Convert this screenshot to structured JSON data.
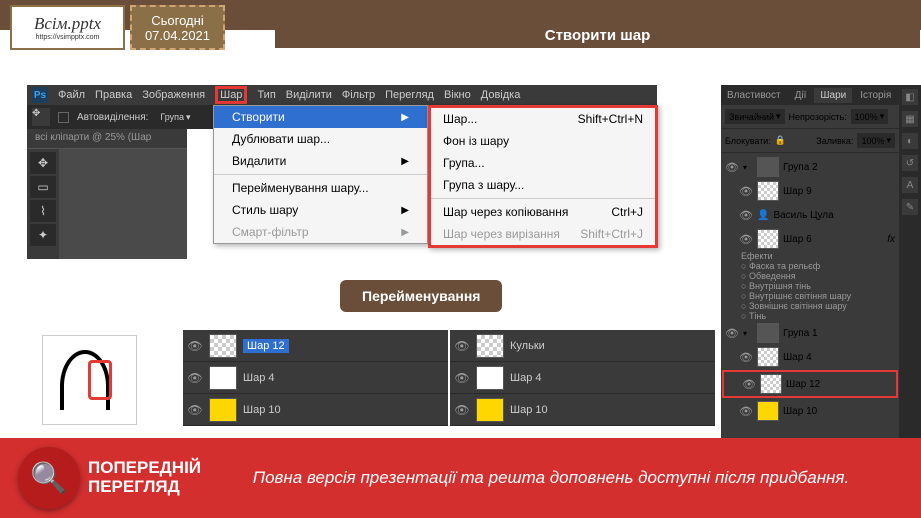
{
  "header": {
    "logo": "Всім.pptx",
    "url": "https://vsimpptx.com",
    "today_label": "Сьогодні",
    "date": "07.04.2021",
    "title": "Створити шар"
  },
  "menubar": {
    "items": [
      "Файл",
      "Правка",
      "Зображення",
      "Шар",
      "Тип",
      "Виділити",
      "Фільтр",
      "Перегляд",
      "Вікно",
      "Довідка"
    ]
  },
  "toolbar": {
    "autoselect": "Автовиділення:",
    "group": "Група"
  },
  "doctab": "всі кліпарти @ 25% (Шар",
  "dropdown": {
    "create": "Створити",
    "duplicate": "Дублювати шар...",
    "delete": "Видалити",
    "rename": "Перейменування шару...",
    "style": "Стиль шару",
    "smart": "Смарт-фільтр"
  },
  "submenu": {
    "layer": "Шар...",
    "layer_shortcut": "Shift+Ctrl+N",
    "bg": "Фон із шару",
    "group": "Група...",
    "group_from": "Група з шару...",
    "copy": "Шар через копіювання",
    "copy_sc": "Ctrl+J",
    "cut": "Шар через вирізання",
    "cut_sc": "Shift+Ctrl+J"
  },
  "rename_badge": "Перейменування",
  "panel1": {
    "edit": "Шар 12",
    "r2": "Шар 4",
    "r3": "Шар 10"
  },
  "panel2": {
    "r1": "Кульки",
    "r2": "Шар 4",
    "r3": "Шар 10"
  },
  "right": {
    "tabs": [
      "Властивост",
      "Дії",
      "Шари",
      "Історія"
    ],
    "mode": "Звичайний",
    "opacity_label": "Непрозорість:",
    "opacity": "100%",
    "lock": "Блокувати:",
    "fill_label": "Заливка:",
    "fill": "100%",
    "g2": "Група 2",
    "l9": "Шар 9",
    "vasyl": "Василь Цула",
    "l6": "Шар 6",
    "fx": "fx",
    "effects": "Ефекти",
    "bevel": "Фаска та рельєф",
    "stroke": "Обведення",
    "inner": "Внутрішня тінь",
    "inner_glow": "Внутрішнє світіння шару",
    "outer_glow": "Зовнішнє світіння шару",
    "drop": "Тінь",
    "g1": "Група 1",
    "l4": "Шар 4",
    "l12": "Шар 12",
    "l10": "Шар 10"
  },
  "banner": {
    "preview1": "ПОПЕРЕДНІЙ",
    "preview2": "ПЕРЕГЛЯД",
    "text": "Повна версія презентації та решта доповнень доступні після придбання."
  }
}
